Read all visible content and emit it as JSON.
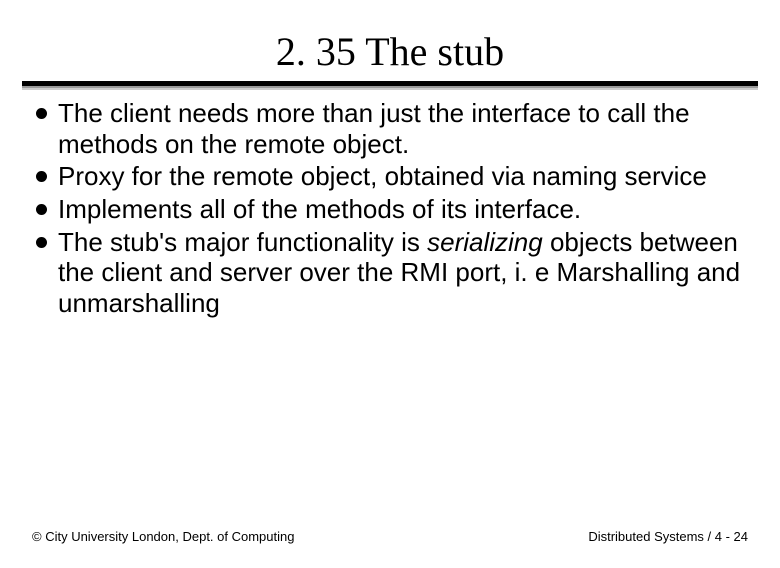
{
  "title": "2. 35 The stub",
  "bullets": [
    {
      "text": "The client needs more than just the interface to call the methods on the remote object."
    },
    {
      "text": " Proxy for the remote object, obtained via naming service"
    },
    {
      "text": " Implements all of the methods of its interface."
    },
    {
      "pre": "The stub's major functionality is ",
      "em": "serializing",
      "post": " objects between the client and server over the RMI port,  i. e Marshalling and unmarshalling"
    }
  ],
  "footer": {
    "left": "© City University London, Dept. of Computing",
    "right": "Distributed Systems / 4 - 24"
  }
}
